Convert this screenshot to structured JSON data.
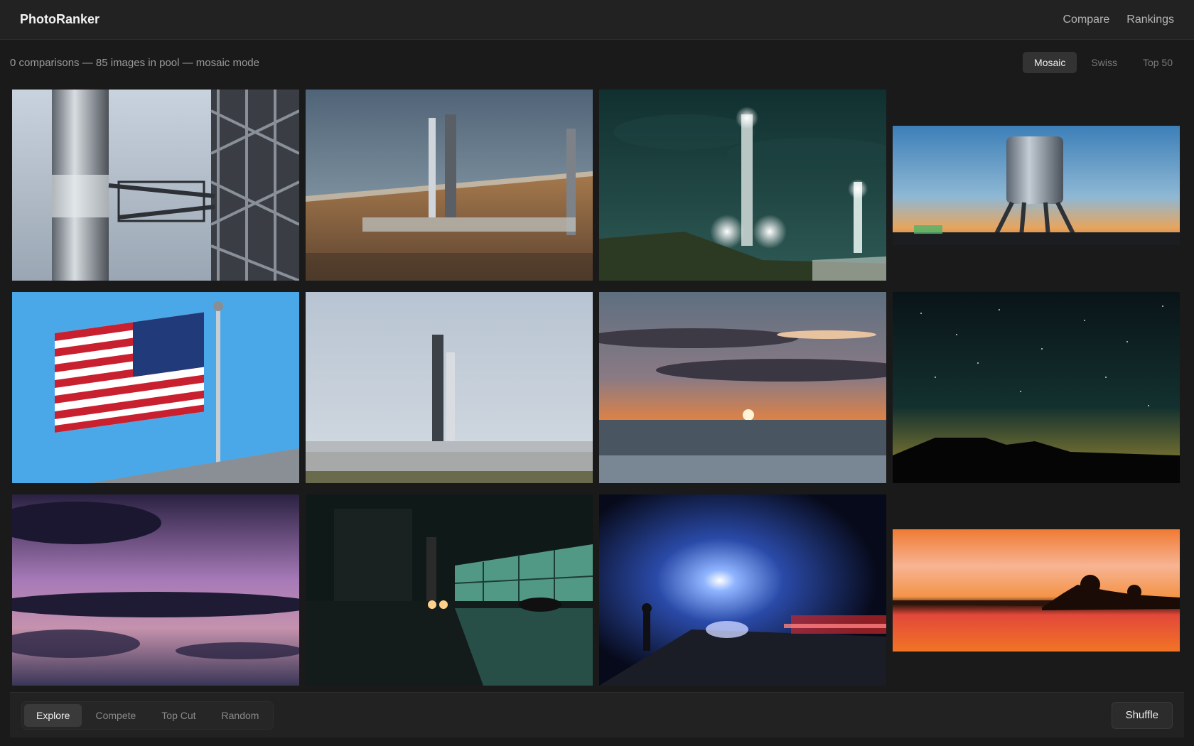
{
  "app": {
    "title": "PhotoRanker"
  },
  "nav": {
    "compare": "Compare",
    "rankings": "Rankings"
  },
  "status": {
    "text": "0 comparisons — 85 images in pool — mosaic mode"
  },
  "modes": [
    "Mosaic",
    "Swiss",
    "Top 50"
  ],
  "active_mode": "Mosaic",
  "photos": [
    {
      "subject": "rocket-tower-closeup"
    },
    {
      "subject": "launch-site-coast"
    },
    {
      "subject": "night-tower-lights"
    },
    {
      "subject": "water-tower-sunset"
    },
    {
      "subject": "american-flag"
    },
    {
      "subject": "launch-tower-daylight"
    },
    {
      "subject": "ocean-sunset"
    },
    {
      "subject": "starry-night"
    },
    {
      "subject": "purple-storm-sky"
    },
    {
      "subject": "rainy-night-building"
    },
    {
      "subject": "night-road-lights"
    },
    {
      "subject": "orange-lake-sunset"
    }
  ],
  "bottom_tabs": [
    "Explore",
    "Compete",
    "Top Cut",
    "Random"
  ],
  "active_tab": "Explore",
  "shuffle_label": "Shuffle",
  "colors": {
    "background": "#1a1a1a",
    "panel": "#222222",
    "active": "#3a3a3a"
  }
}
